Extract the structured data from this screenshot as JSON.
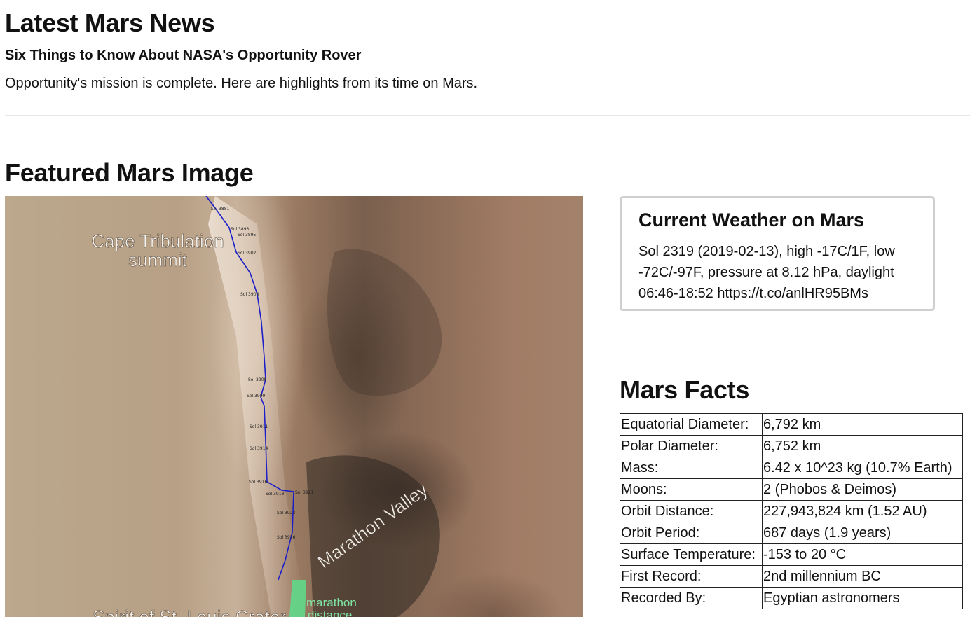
{
  "news": {
    "section_title": "Latest Mars News",
    "headline": "Six Things to Know About NASA's Opportunity Rover",
    "teaser": "Opportunity's mission is complete. Here are highlights from its time on Mars."
  },
  "featured": {
    "section_title": "Featured Mars Image",
    "image_labels": {
      "cape": "Cape Tribulation",
      "summit": "summit",
      "valley": "Marathon Valley",
      "marathon": "marathon",
      "distance": "distance",
      "crater": "Spirit of St. Louis Crater"
    },
    "sol_markers": [
      "Sol 3881",
      "Sol 3893",
      "Sol 3895",
      "Sol 3902",
      "Sol 3906",
      "Sol 3908",
      "Sol 3909",
      "Sol 3911",
      "Sol 3914",
      "Sol 3916",
      "Sol 3918",
      "Sol 3921",
      "Sol 3923",
      "Sol 3926"
    ]
  },
  "weather": {
    "title": "Current Weather on Mars",
    "text": "Sol 2319 (2019-02-13), high -17C/1F, low -72C/-97F, pressure at 8.12 hPa, daylight 06:46-18:52 https://t.co/anlHR95BMs"
  },
  "facts": {
    "title": "Mars Facts",
    "rows": [
      {
        "label": "Equatorial Diameter:",
        "value": "6,792 km"
      },
      {
        "label": "Polar Diameter:",
        "value": "6,752 km"
      },
      {
        "label": "Mass:",
        "value": "6.42 x 10^23 kg (10.7% Earth)"
      },
      {
        "label": "Moons:",
        "value": "2 (Phobos & Deimos)"
      },
      {
        "label": "Orbit Distance:",
        "value": "227,943,824 km (1.52 AU)"
      },
      {
        "label": "Orbit Period:",
        "value": "687 days (1.9 years)"
      },
      {
        "label": "Surface Temperature:",
        "value": "-153 to 20 °C"
      },
      {
        "label": "First Record:",
        "value": "2nd millennium BC"
      },
      {
        "label": "Recorded By:",
        "value": "Egyptian astronomers"
      }
    ]
  }
}
